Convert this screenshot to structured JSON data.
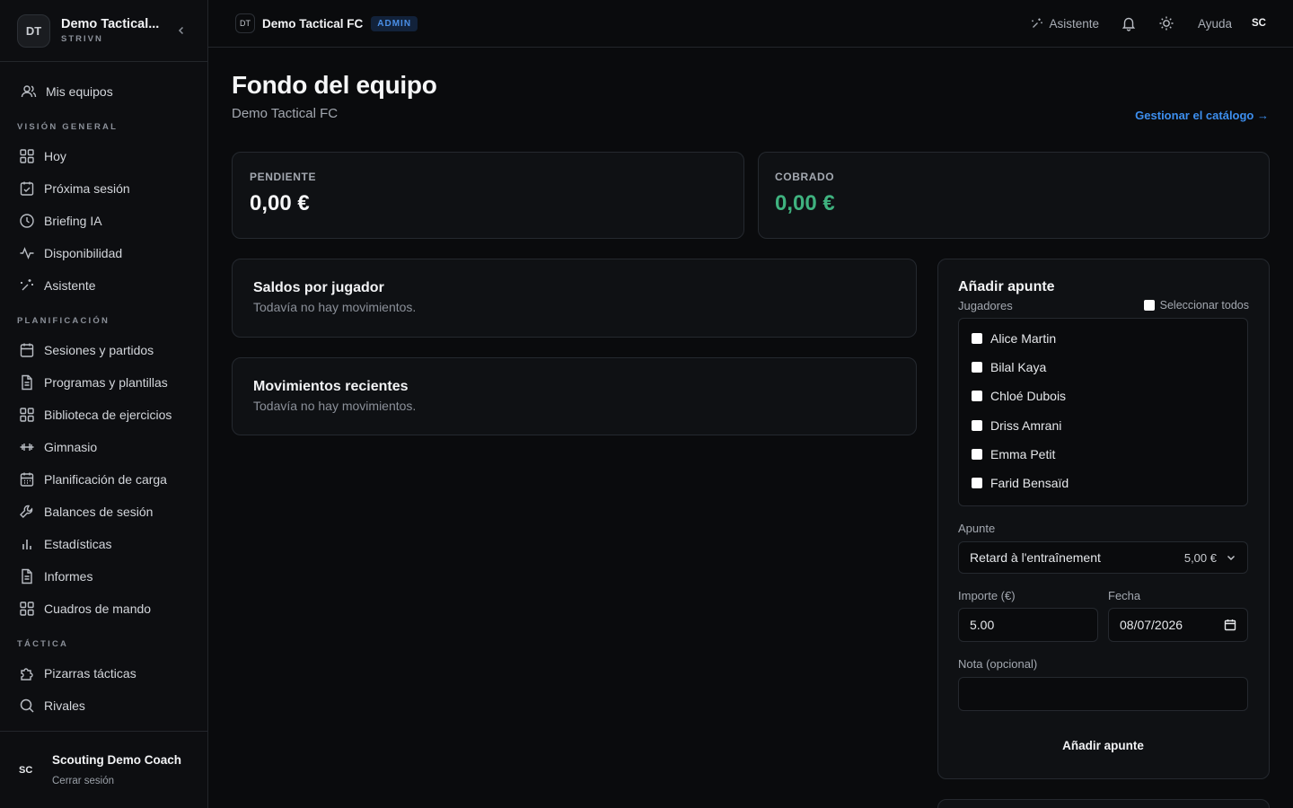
{
  "sidebar": {
    "team_initials": "DT",
    "team_name": "Demo Tactical...",
    "team_sub": "STRIVN",
    "top_item": "Mis equipos",
    "sections": [
      {
        "title": "VISIÓN GENERAL",
        "items": [
          "Hoy",
          "Próxima sesión",
          "Briefing IA",
          "Disponibilidad",
          "Asistente"
        ]
      },
      {
        "title": "PLANIFICACIÓN",
        "items": [
          "Sesiones y partidos",
          "Programas y plantillas",
          "Biblioteca de ejercicios",
          "Gimnasio",
          "Planificación de carga",
          "Balances de sesión",
          "Estadísticas",
          "Informes",
          "Cuadros de mando"
        ]
      },
      {
        "title": "TÁCTICA",
        "items": [
          "Pizarras tácticas",
          "Rivales"
        ]
      }
    ],
    "user": {
      "initials": "SC",
      "name": "Scouting Demo Coach",
      "logout": "Cerrar sesión"
    }
  },
  "topbar": {
    "team_initials": "DT",
    "team_name": "Demo Tactical FC",
    "badge": "ADMIN",
    "assistant": "Asistente",
    "help": "Ayuda",
    "user_initials": "SC"
  },
  "page": {
    "title": "Fondo del equipo",
    "subtitle": "Demo Tactical FC",
    "catalog_link": "Gestionar el catálogo →"
  },
  "stats": {
    "pending_label": "PENDIENTE",
    "pending_value": "0,00 €",
    "collected_label": "COBRADO",
    "collected_value": "0,00 €"
  },
  "balances": {
    "title": "Saldos por jugador",
    "empty": "Todavía no hay movimientos."
  },
  "movements": {
    "title": "Movimientos recientes",
    "empty": "Todavía no hay movimientos."
  },
  "form": {
    "title": "Añadir apunte",
    "players_label": "Jugadores",
    "select_all": "Seleccionar todos",
    "players": [
      "Alice Martin",
      "Bilal Kaya",
      "Chloé Dubois",
      "Driss Amrani",
      "Emma Petit",
      "Farid Bensaïd"
    ],
    "entry_label": "Apunte",
    "entry_value": "Retard à l'entraînement",
    "entry_price": "5,00 €",
    "amount_label": "Importe (€)",
    "amount_value": "5.00",
    "date_label": "Fecha",
    "date_value": "08/07/2026",
    "note_label": "Nota (opcional)",
    "note_value": "",
    "submit": "Añadir apunte"
  },
  "colors": {
    "accent": "#3d8fef",
    "success": "#3fb27f",
    "background": "#0a0b0d"
  }
}
